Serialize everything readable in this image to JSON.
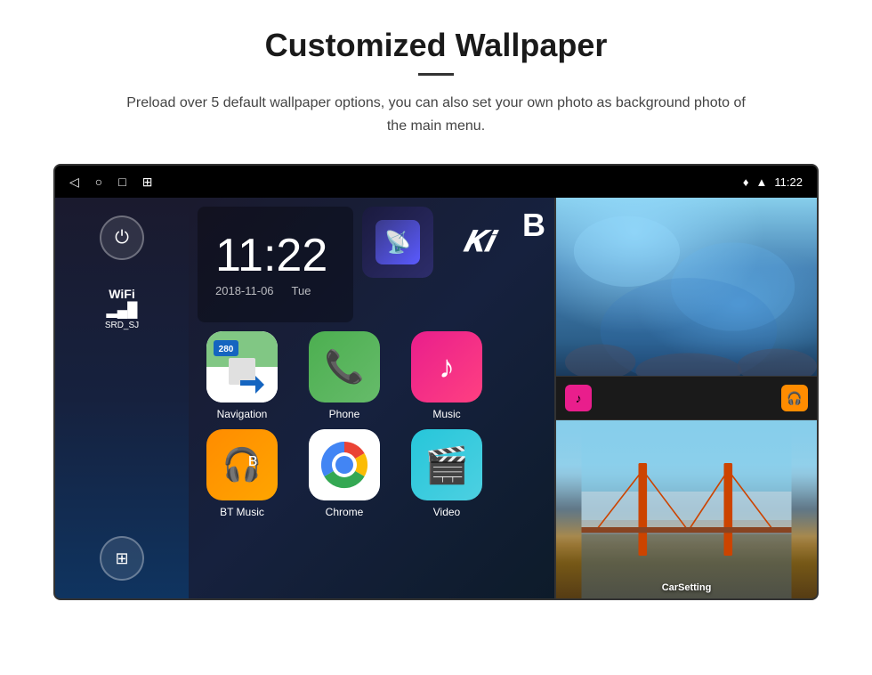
{
  "page": {
    "title": "Customized Wallpaper",
    "divider": true,
    "description": "Preload over 5 default wallpaper options, you can also set your own photo as background photo of the main menu."
  },
  "device": {
    "status_bar": {
      "nav_icons": [
        "◁",
        "○",
        "□",
        "⊞"
      ],
      "right_icons": [
        "location",
        "wifi",
        "time"
      ],
      "time": "11:22"
    },
    "sidebar": {
      "power_label": "⏻",
      "wifi_label": "WiFi",
      "wifi_bars": "▂▄▆",
      "wifi_ssid": "SRD_SJ",
      "apps_icon": "⊞"
    },
    "clock": {
      "time": "11:22",
      "date_left": "2018-11-06",
      "date_right": "Tue"
    },
    "apps_row1": [
      {
        "name": "Navigation",
        "icon_type": "navigation"
      },
      {
        "name": "Phone",
        "icon_type": "phone"
      },
      {
        "name": "Music",
        "icon_type": "music"
      }
    ],
    "apps_row2": [
      {
        "name": "BT Music",
        "icon_type": "bt_music"
      },
      {
        "name": "Chrome",
        "icon_type": "chrome"
      },
      {
        "name": "Video",
        "icon_type": "video"
      }
    ],
    "right_panel": {
      "top_label": "Ice cave wallpaper",
      "middle_apps": [
        {
          "name": "mini-app-1",
          "color": "#E91E8C"
        },
        {
          "name": "mini-app-2",
          "color": "#FF8C00"
        }
      ],
      "bottom_label": "CarSetting"
    }
  },
  "colors": {
    "nav_bg": "#4CAF50",
    "phone_bg": "#4CAF50",
    "music_bg": "#E91E8C",
    "bt_bg": "#FF8C00",
    "chrome_red": "#EA4335",
    "chrome_yellow": "#FBBC05",
    "chrome_green": "#34A853",
    "chrome_blue": "#4285F4",
    "video_bg": "#4DD0E1",
    "brand_dark": "#1a1a2e"
  }
}
